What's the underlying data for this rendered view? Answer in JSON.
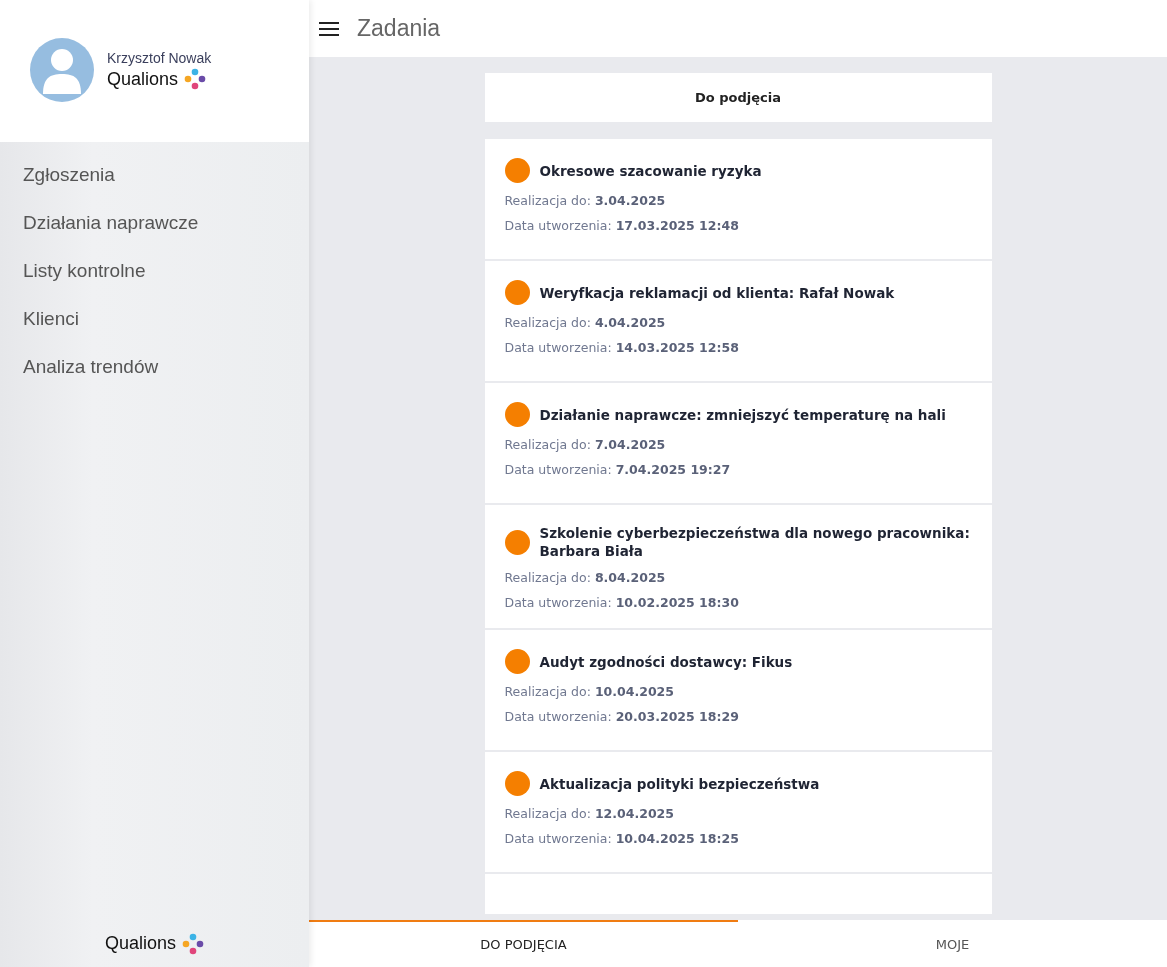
{
  "user": {
    "name": "Krzysztof Nowak",
    "brand": "Qualions"
  },
  "sidebar": {
    "items": [
      {
        "label": "Zgłoszenia"
      },
      {
        "label": "Działania naprawcze"
      },
      {
        "label": "Listy kontrolne"
      },
      {
        "label": "Klienci"
      },
      {
        "label": "Analiza trendów"
      }
    ],
    "footer_brand": "Qualions"
  },
  "header": {
    "title": "Zadania"
  },
  "section_title": "Do podjęcia",
  "tasks": [
    {
      "title": "Okresowe szacowanie ryzyka",
      "color": "#f57f00",
      "due_label": "Realizacja do:",
      "due": "3.04.2025",
      "created_label": "Data utworzenia:",
      "created": "17.03.2025 12:48"
    },
    {
      "title": "Weryfkacja reklamacji od klienta: Rafał Nowak",
      "color": "#f57f00",
      "due_label": "Realizacja do:",
      "due": "4.04.2025",
      "created_label": "Data utworzenia:",
      "created": "14.03.2025 12:58"
    },
    {
      "title": "Działanie naprawcze: zmniejszyć temperaturę na hali",
      "color": "#f57f00",
      "due_label": "Realizacja do:",
      "due": "7.04.2025",
      "created_label": "Data utworzenia:",
      "created": "7.04.2025 19:27"
    },
    {
      "title": "Szkolenie cyberbezpieczeństwa dla nowego pracownika: Barbara Biała",
      "color": "#f57f00",
      "due_label": "Realizacja do:",
      "due": "8.04.2025",
      "created_label": "Data utworzenia:",
      "created": "10.02.2025 18:30"
    },
    {
      "title": "Audyt zgodności dostawcy: Fikus",
      "color": "#f57f00",
      "due_label": "Realizacja do:",
      "due": "10.04.2025",
      "created_label": "Data utworzenia:",
      "created": "20.03.2025 18:29"
    },
    {
      "title": "Aktualizacja polityki bezpieczeństwa",
      "color": "#f57f00",
      "due_label": "Realizacja do:",
      "due": "12.04.2025",
      "created_label": "Data utworzenia:",
      "created": "10.04.2025 18:25"
    }
  ],
  "tabs": [
    {
      "label": "DO PODJĘCIA",
      "selected": true
    },
    {
      "label": "MOJE",
      "selected": false
    }
  ]
}
